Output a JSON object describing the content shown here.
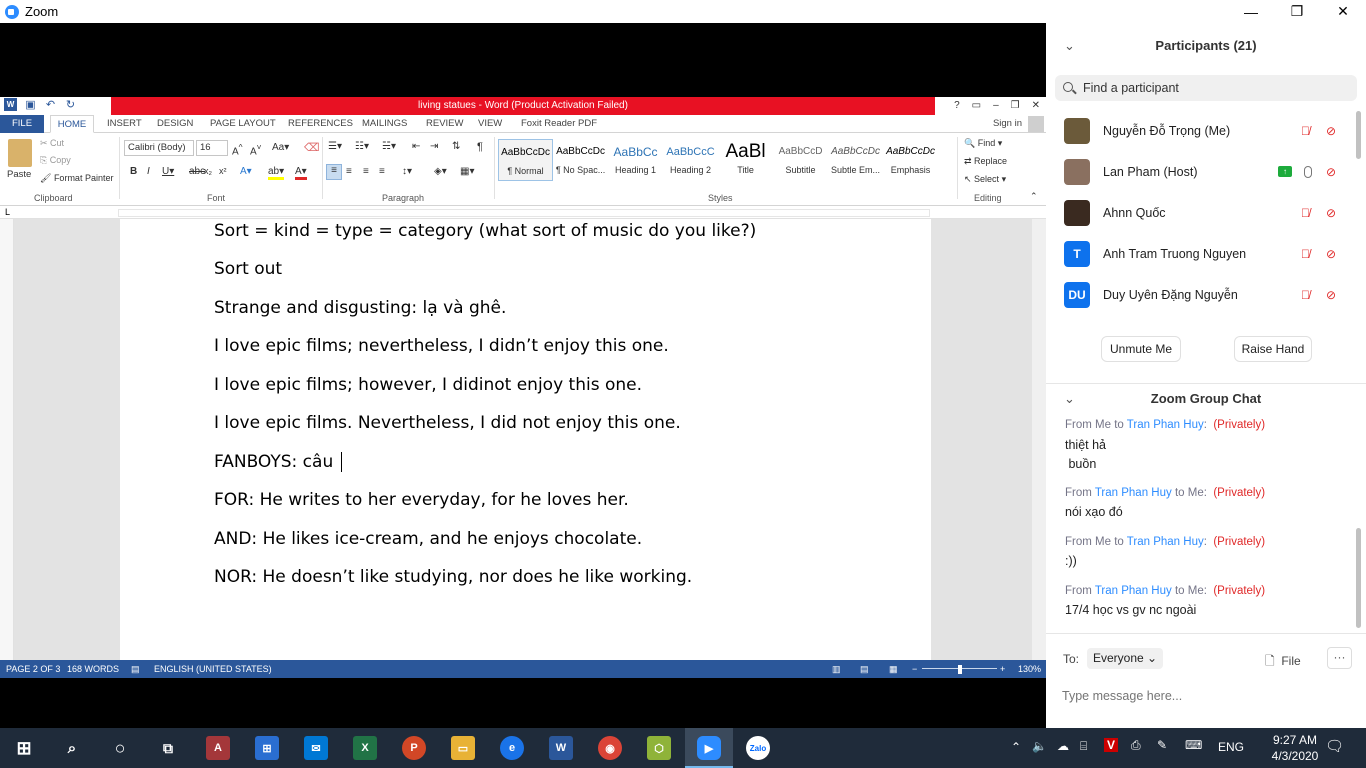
{
  "zoom": {
    "title": "Zoom",
    "window_controls": [
      "—",
      "❐",
      "✕"
    ]
  },
  "word": {
    "title": "living statues -  Word (Product Activation Failed)",
    "qat_icons": [
      "word-icon",
      "save-icon",
      "undo-icon",
      "redo-icon"
    ],
    "window_controls": [
      "?",
      "▭",
      "–",
      "❐",
      "✕"
    ],
    "tabs": [
      "FILE",
      "HOME",
      "INSERT",
      "DESIGN",
      "PAGE LAYOUT",
      "REFERENCES",
      "MAILINGS",
      "REVIEW",
      "VIEW",
      "Foxit Reader PDF"
    ],
    "sign_in": "Sign in",
    "clipboard": {
      "paste": "Paste",
      "cut": "Cut",
      "copy": "Copy",
      "format_painter": "Format Painter",
      "label": "Clipboard"
    },
    "font": {
      "name": "Calibri (Body)",
      "size": "16",
      "label": "Font"
    },
    "paragraph": {
      "label": "Paragraph"
    },
    "styles": {
      "label": "Styles",
      "items": [
        {
          "sample": "AaBbCcDc",
          "name": "¶ Normal"
        },
        {
          "sample": "AaBbCcDc",
          "name": "¶ No Spac..."
        },
        {
          "sample": "AaBbCc",
          "name": "Heading 1"
        },
        {
          "sample": "AaBbCcC",
          "name": "Heading 2"
        },
        {
          "sample": "AaBl",
          "name": "Title"
        },
        {
          "sample": "AaBbCcD",
          "name": "Subtitle"
        },
        {
          "sample": "AaBbCcDc",
          "name": "Subtle Em..."
        },
        {
          "sample": "AaBbCcDc",
          "name": "Emphasis"
        }
      ]
    },
    "editing": {
      "find": "Find",
      "replace": "Replace",
      "select": "Select",
      "label": "Editing"
    },
    "document_lines": [
      "Sort = kind = type = category (what sort of music do you like?)",
      "Sort out",
      "Strange and disgusting: lạ và ghê.",
      "I love epic films; nevertheless, I didn’t enjoy this one.",
      "I love epic films; however, I didinot enjoy this one.",
      "I love epic films. Nevertheless, I did not enjoy this one.",
      "FANBOYS: câu",
      "FOR: He writes to her everyday, for he loves her.",
      "AND: He likes ice-cream, and he enjoys chocolate.",
      "NOR: He doesn’t like studying, nor does he like working."
    ],
    "status": {
      "page": "PAGE 2 OF 3",
      "words": "168 WORDS",
      "language": "ENGLISH (UNITED STATES)",
      "zoom": "130%"
    }
  },
  "participants_panel": {
    "title": "Participants (21)",
    "search_placeholder": "Find a participant",
    "participants": [
      {
        "name": "Nguyễn Đỗ Trọng  (Me)",
        "avatar_color": "#6b5a3a",
        "initials": ""
      },
      {
        "name": "Lan Pham (Host)",
        "avatar_color": "#8a7060",
        "initials": ""
      },
      {
        "name": "Ahnn Quốc",
        "avatar_color": "#3a2a20",
        "initials": ""
      },
      {
        "name": "Anh Tram Truong Nguyen",
        "avatar_color": "#0e72ed",
        "initials": "T"
      },
      {
        "name": "Duy Uyên Đặng Nguyễn",
        "avatar_color": "#0e72ed",
        "initials": "DU"
      }
    ],
    "unmute": "Unmute Me",
    "raise_hand": "Raise Hand"
  },
  "chat": {
    "title": "Zoom Group Chat",
    "messages": [
      {
        "from": "Me",
        "to": "Tran Phan Huy",
        "privately": "(Privately)",
        "text": "thiệt hả\n buồn"
      },
      {
        "from": "Tran Phan Huy",
        "to": "Me",
        "privately": "(Privately)",
        "text": "nói xạo đó"
      },
      {
        "from": "Me",
        "to": "Tran Phan Huy",
        "privately": "(Privately)",
        "text": ":))"
      },
      {
        "from": "Tran Phan Huy",
        "to": "Me",
        "privately": "(Privately)",
        "text": "17/4 học vs gv nc ngoài"
      }
    ],
    "to_label": "To:",
    "to_value": "Everyone",
    "file": "File",
    "input_placeholder": "Type message here..."
  },
  "taskbar": {
    "time": "9:27 AM",
    "date": "4/3/2020",
    "lang": "ENG",
    "apps": [
      "start-icon",
      "search-icon",
      "cortana-icon",
      "task-view-icon",
      "access-icon",
      "store-icon",
      "mail-icon",
      "excel-icon",
      "powerpoint-icon",
      "explorer-icon",
      "edge-icon",
      "word-icon",
      "chrome-icon",
      "box-icon",
      "zoom-icon",
      "zalo-icon"
    ]
  }
}
